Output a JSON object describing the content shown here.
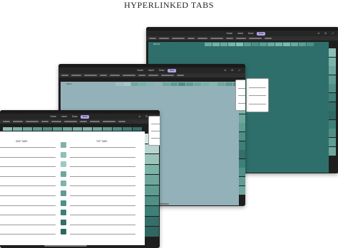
{
  "title": "HYPERLINKED TABS",
  "tablets": [
    {
      "id": "back",
      "tab_label": "Tab 10",
      "menus": [
        "Home",
        "Insert",
        "Draw",
        "View"
      ],
      "active_menu": "View",
      "page_color": "#2e6f6b",
      "top_tab_colors": [
        "#6fa79e",
        "#78b0a7",
        "#6fa79e",
        "#7cb4a9",
        "#89bcb2",
        "#5f9c92",
        "#4f8f86",
        "#5f9c92",
        "#6fa79e",
        "#78b0a7",
        "#84b6ad",
        "#6fa79e",
        "#5f9c92",
        "#4f8f86"
      ],
      "active_tab_color": "#2e6f6b",
      "side_tab_colors": [
        "#8dbfb6",
        "#7cb4a9",
        "#6fa79e",
        "#5f9c92",
        "#4f8f86",
        "#3e7f77",
        "#356f6a",
        "#2f6863",
        "#3e7f77",
        "#4f8f86",
        "#5f9c92",
        "#6fa79e"
      ]
    },
    {
      "id": "middle",
      "tab_label": "Tab 5",
      "menus": [
        "Home",
        "Insert",
        "Draw",
        "View"
      ],
      "active_menu": "View",
      "page_color": "#93b1b9",
      "top_tab_colors": [
        "#9fbfc4",
        "#a7c6ca",
        "#6fa79e",
        "#78b0a7",
        "#84b6ad",
        "#93b1b9",
        "#6fa79e",
        "#5f9c92",
        "#4f8f86",
        "#5f9c92",
        "#6fa79e",
        "#78b0a7",
        "#84b6ad",
        "#6fa79e",
        "#5f9c92",
        "#4f8f86"
      ],
      "side_tab_colors": [
        "#a6c4c8",
        "#8dbfb6",
        "#7cb4a9",
        "#6fa79e",
        "#5f9c92",
        "#4f8f86",
        "#3e7f77",
        "#356f6a",
        "#3e7f77",
        "#4f8f86",
        "#5f9c92",
        "#6fa79e"
      ]
    },
    {
      "id": "front",
      "menus": [
        "Home",
        "Insert",
        "Draw",
        "View"
      ],
      "active_menu": "View",
      "page_color": "#ffffff",
      "side_tabs_label": "SIDE TABS",
      "top_tabs_label": "TOP TABS",
      "top_tab_colors": [
        "#8dbfb6",
        "#7cb4a9",
        "#6fa79e",
        "#5f9c92",
        "#4f8f86",
        "#5f9c92",
        "#6fa79e",
        "#78b0a7",
        "#84b6ad",
        "#6fa79e",
        "#5f9c92",
        "#4f8f86",
        "#3e7f77",
        "#356f6a"
      ],
      "side_tab_colors": [
        "#d6e7e3",
        "#b8d6cf",
        "#9bc4bb",
        "#7cb4a9",
        "#6fa79e",
        "#5f9c92",
        "#4f8f86",
        "#3e7f77",
        "#356f6a",
        "#2f6863"
      ],
      "icon_colors": [
        "#7fb3aa",
        "#8fbfb5",
        "#9ccac1",
        "#6fa79e",
        "#7cb4a9",
        "#5f9c92",
        "#4f8f86",
        "#3e7f77",
        "#356f6a",
        "#2f6863"
      ]
    }
  ]
}
